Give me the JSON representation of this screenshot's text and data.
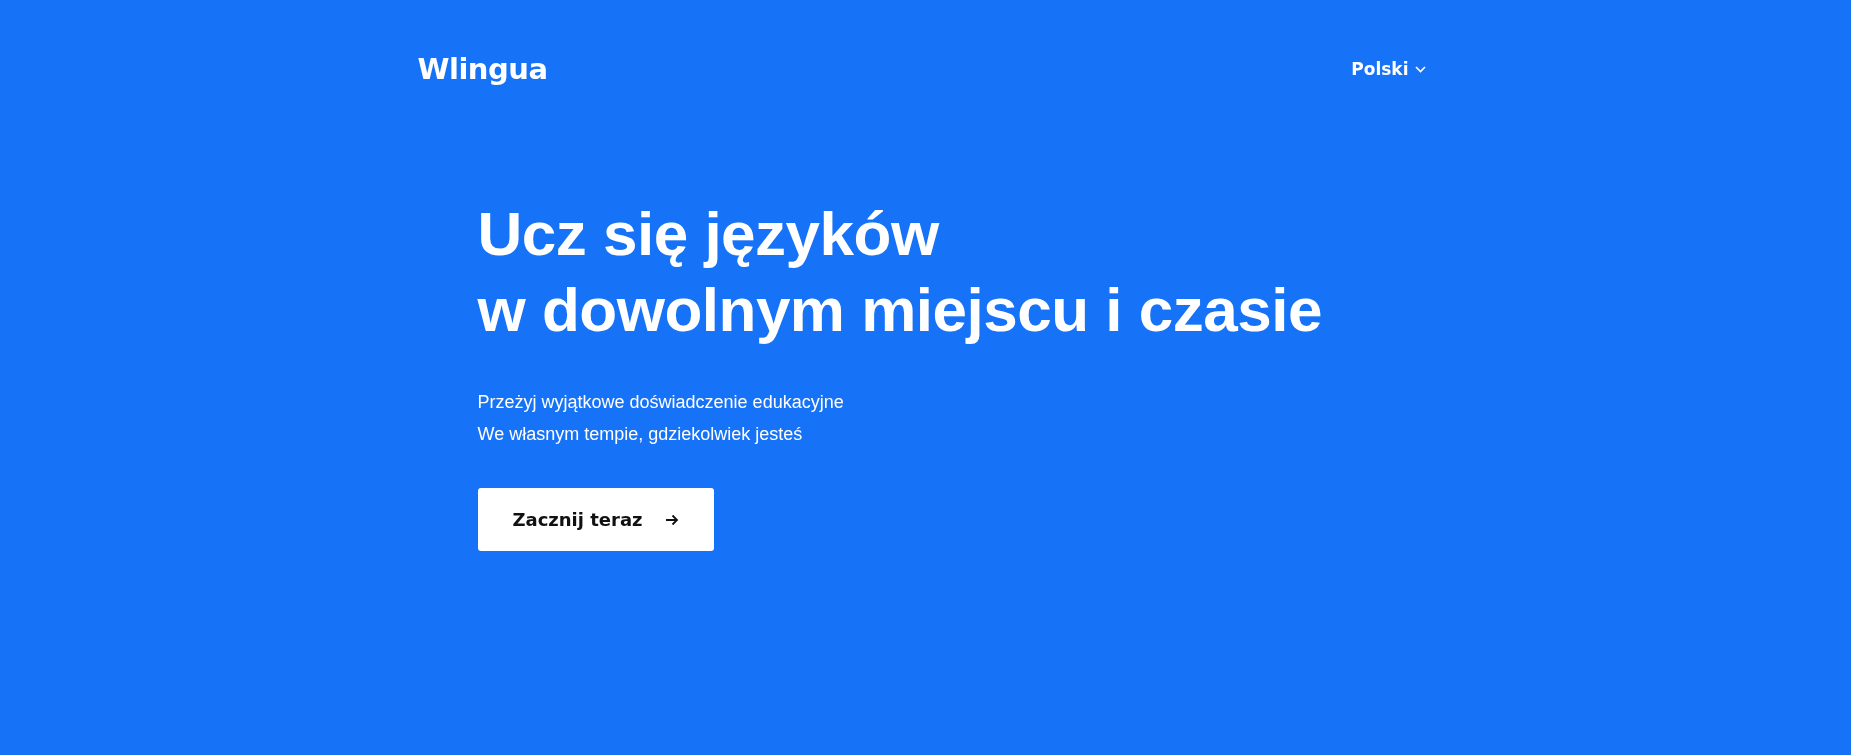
{
  "header": {
    "logo": "Wlingua",
    "language": "Polski"
  },
  "hero": {
    "title_lines": [
      "Ucz się języków",
      "w dowolnym miejscu i czasie"
    ],
    "subtitle_lines": [
      "Przeżyj wyjątkowe doświadczenie edukacyjne",
      "We własnym tempie, gdziekolwiek jesteś"
    ],
    "cta": "Zacznij teraz"
  }
}
